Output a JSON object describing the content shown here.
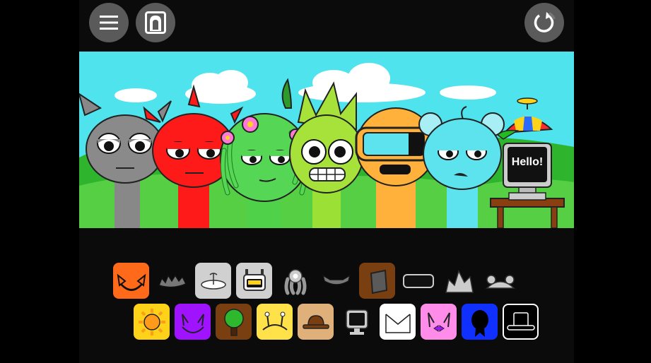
{
  "toolbar": {
    "menu_icon": "hamburger-icon",
    "portrait_icon": "portrait-icon",
    "reset_icon": "reset-icon"
  },
  "stage": {
    "sky_color": "#4fe3ee",
    "grass_color": "#3fc23a",
    "monitor_text": "Hello!",
    "characters": [
      {
        "name": "gray",
        "color": "#8a8a8a"
      },
      {
        "name": "red",
        "color": "#ff1a1a"
      },
      {
        "name": "green",
        "color": "#55d655"
      },
      {
        "name": "lime",
        "color": "#a6e23a"
      },
      {
        "name": "orange",
        "color": "#ffb13b"
      },
      {
        "name": "cyan",
        "color": "#5de3ee"
      },
      {
        "name": "computer",
        "color": "#555555"
      }
    ]
  },
  "palette": {
    "row1": [
      {
        "icon": "orange-ears-icon",
        "bg": "#ff6a1a"
      },
      {
        "icon": "spiky-hair-icon",
        "bg": "transparent"
      },
      {
        "icon": "antenna-dish-icon",
        "bg": "#d0d0d0"
      },
      {
        "icon": "robot-face-icon",
        "bg": "#d0d0d0"
      },
      {
        "icon": "flower-crown-icon",
        "bg": "transparent"
      },
      {
        "icon": "horns-icon",
        "bg": "transparent"
      },
      {
        "icon": "bucket-icon",
        "bg": "#7a3f10"
      },
      {
        "icon": "visor-icon",
        "bg": "transparent"
      },
      {
        "icon": "crown-spikes-icon",
        "bg": "transparent"
      },
      {
        "icon": "mouse-ears-icon",
        "bg": "transparent"
      }
    ],
    "row2": [
      {
        "icon": "sun-icon",
        "bg": "#ffd21a"
      },
      {
        "icon": "purple-horns-icon",
        "bg": "#a013ff"
      },
      {
        "icon": "tree-icon",
        "bg": "#7a3f10"
      },
      {
        "icon": "yellow-antenna-icon",
        "bg": "#ffe24a"
      },
      {
        "icon": "bowler-hat-icon",
        "bg": "#e0b07a"
      },
      {
        "icon": "computer-monitor-icon",
        "bg": "transparent"
      },
      {
        "icon": "envelope-icon",
        "bg": "#ffffff"
      },
      {
        "icon": "bow-ears-icon",
        "bg": "#ff8ce8"
      },
      {
        "icon": "medal-icon",
        "bg": "#1030ff"
      },
      {
        "icon": "top-hat-icon",
        "bg": "#000000"
      }
    ]
  }
}
